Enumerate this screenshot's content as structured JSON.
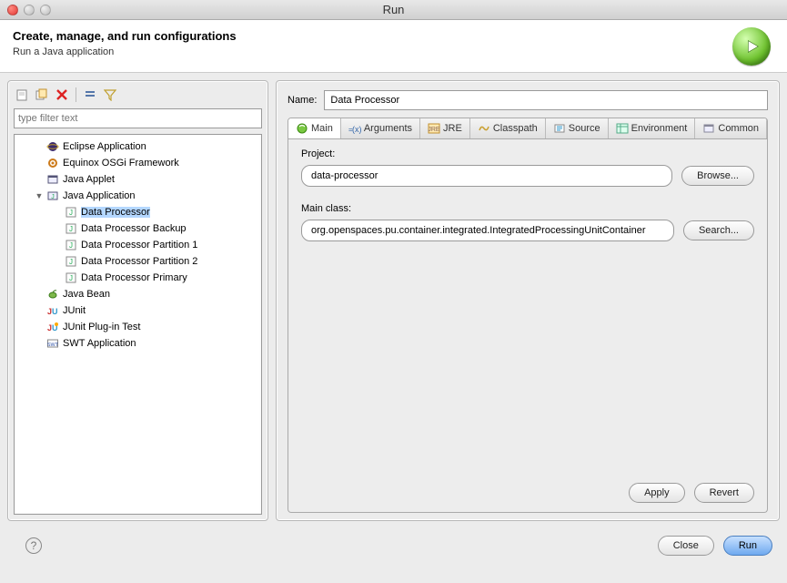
{
  "window": {
    "title": "Run"
  },
  "header": {
    "title": "Create, manage, and run configurations",
    "subtitle": "Run a Java application"
  },
  "filter": {
    "placeholder": "type filter text"
  },
  "tree": {
    "items": [
      {
        "label": "Eclipse Application",
        "icon": "eclipse"
      },
      {
        "label": "Equinox OSGi Framework",
        "icon": "osgi"
      },
      {
        "label": "Java Applet",
        "icon": "applet"
      },
      {
        "label": "Java Application",
        "icon": "java",
        "expanded": true,
        "children": [
          {
            "label": "Data Processor",
            "selected": true
          },
          {
            "label": "Data Processor Backup"
          },
          {
            "label": "Data Processor Partition 1"
          },
          {
            "label": "Data Processor Partition 2"
          },
          {
            "label": "Data Processor Primary"
          }
        ]
      },
      {
        "label": "Java Bean",
        "icon": "bean"
      },
      {
        "label": "JUnit",
        "icon": "junit"
      },
      {
        "label": "JUnit Plug-in Test",
        "icon": "junitplug"
      },
      {
        "label": "SWT Application",
        "icon": "swt"
      }
    ]
  },
  "form": {
    "name_label": "Name:",
    "name_value": "Data Processor",
    "tabs": [
      {
        "label": "Main",
        "icon": "green-circle",
        "active": true
      },
      {
        "label": "Arguments",
        "icon": "xargs"
      },
      {
        "label": "JRE",
        "icon": "jre"
      },
      {
        "label": "Classpath",
        "icon": "classpath"
      },
      {
        "label": "Source",
        "icon": "source"
      },
      {
        "label": "Environment",
        "icon": "env"
      },
      {
        "label": "Common",
        "icon": "common"
      }
    ],
    "project_label": "Project:",
    "project_value": "data-processor",
    "mainclass_label": "Main class:",
    "mainclass_value": "org.openspaces.pu.container.integrated.IntegratedProcessingUnitContainer",
    "browse_btn": "Browse...",
    "search_btn": "Search...",
    "apply_btn": "Apply",
    "revert_btn": "Revert"
  },
  "footer": {
    "close": "Close",
    "run": "Run"
  }
}
